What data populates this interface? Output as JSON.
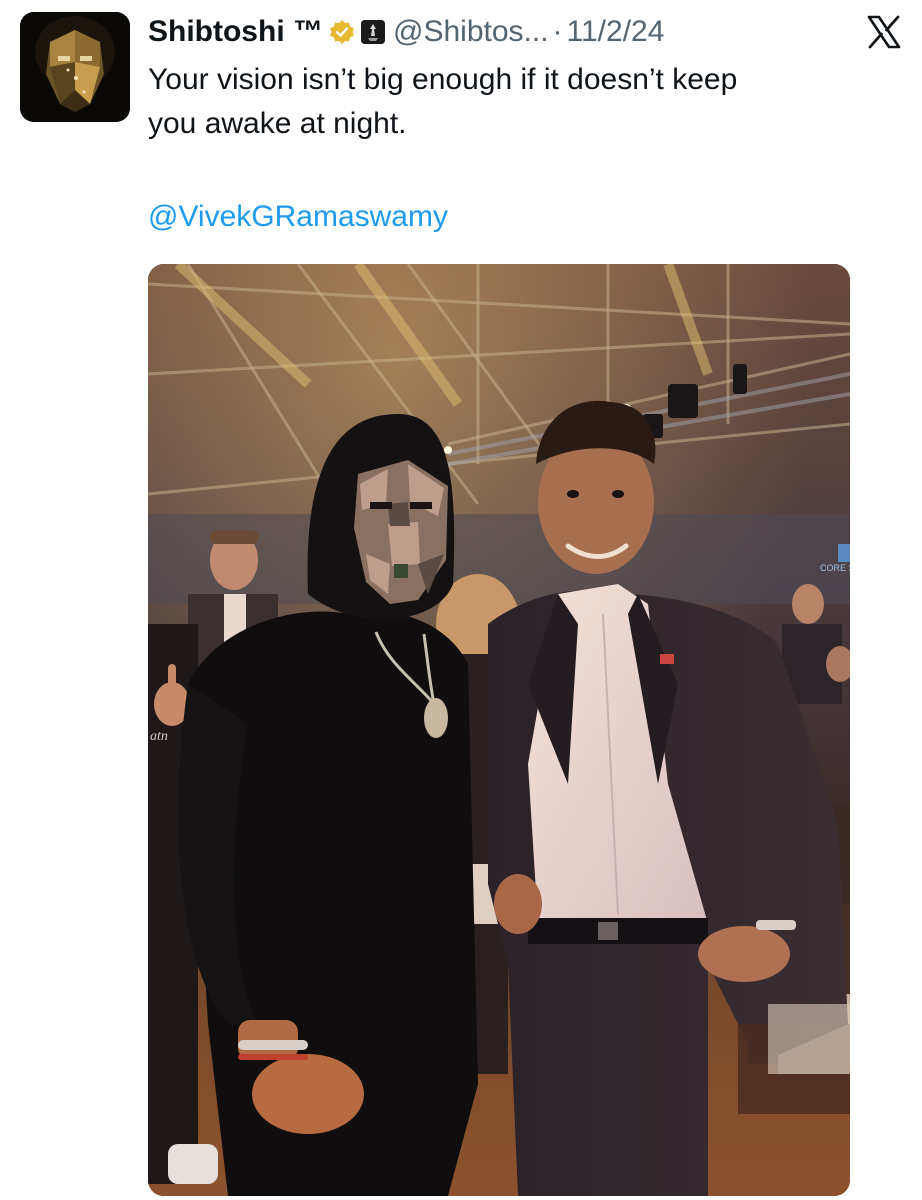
{
  "tweet": {
    "display_name": "Shibtoshi ™",
    "handle": "@Shibtos...",
    "separator": "·",
    "date": "11/2/24",
    "text": "Your vision isn’t big enough if it doesn’t keep\nyou awake at night.",
    "mention": "@VivekGRamaswamy",
    "verified_color": "#e8b830",
    "mention_color": "#1d9bf0"
  },
  "icons": {
    "verified": "verified-badge-icon",
    "affiliate": "affiliate-badge-icon",
    "platform": "x-logo-icon"
  },
  "media": {
    "background_text": "atn",
    "booth_text": "CORE SC"
  }
}
